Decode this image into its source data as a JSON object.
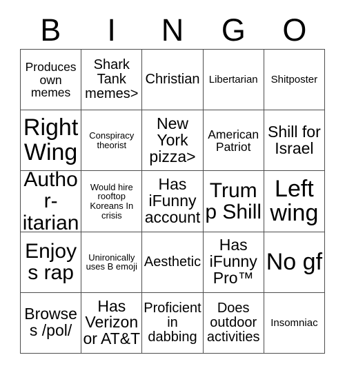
{
  "card": {
    "title": "BINGO",
    "headers": [
      "B",
      "I",
      "N",
      "G",
      "O"
    ],
    "colors": {
      "background": "#ffffff",
      "text": "#000000",
      "border": "#4d4d4d"
    },
    "cells": [
      [
        {
          "text": "Produces own memes",
          "size": "md"
        },
        {
          "text": "Shark Tank memes>",
          "size": "lg"
        },
        {
          "text": "Christian",
          "size": "lg"
        },
        {
          "text": "Libertarian",
          "size": "sm"
        },
        {
          "text": "Shitposter",
          "size": "sm"
        }
      ],
      [
        {
          "text": "Right Wing",
          "size": "huge"
        },
        {
          "text": "Conspiracy theorist",
          "size": "xs"
        },
        {
          "text": "New York pizza>",
          "size": "xl"
        },
        {
          "text": "American Patriot",
          "size": "md"
        },
        {
          "text": "Shill for Israel",
          "size": "xl"
        }
      ],
      [
        {
          "text": "Author-\nitarian",
          "size": "xxl"
        },
        {
          "text": "Would hire rooftop Koreans In crisis",
          "size": "xs"
        },
        {
          "text": "Has iFunny account",
          "size": "xl"
        },
        {
          "text": "Trump Shill",
          "size": "xxl"
        },
        {
          "text": "Left wing",
          "size": "huge"
        }
      ],
      [
        {
          "text": "Enjoys rap",
          "size": "xxl"
        },
        {
          "text": "Unironically uses B emoji",
          "size": "xs"
        },
        {
          "text": "Aesthetic",
          "size": "lg"
        },
        {
          "text": "Has iFunny Pro™",
          "size": "xl"
        },
        {
          "text": "No gf",
          "size": "huge"
        }
      ],
      [
        {
          "text": "Browses /pol/",
          "size": "xl"
        },
        {
          "text": "Has Verizon or AT&T",
          "size": "xl"
        },
        {
          "text": "Proficient in dabbing",
          "size": "lg"
        },
        {
          "text": "Does outdoor activities",
          "size": "lg"
        },
        {
          "text": "Insomniac",
          "size": "sm"
        }
      ]
    ]
  }
}
